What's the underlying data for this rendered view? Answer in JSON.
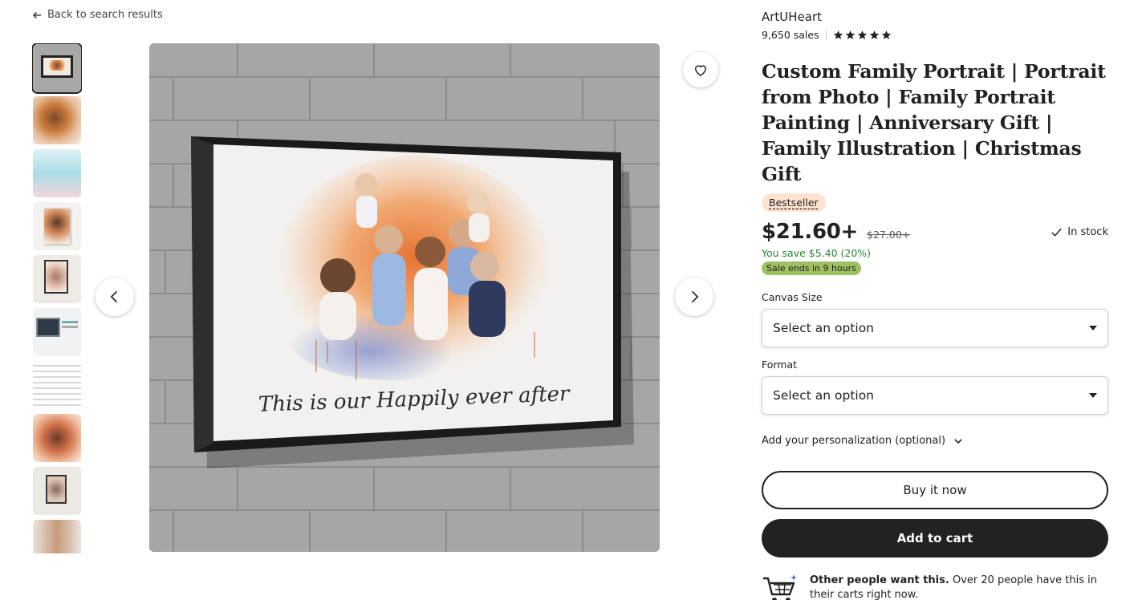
{
  "nav": {
    "back_label": "Back to search results"
  },
  "gallery": {
    "thumbnail_count": 10,
    "active_index": 0,
    "signature_text": "This is our Happily ever after"
  },
  "shop": {
    "name": "ArtUHeart",
    "sales": "9,650 sales",
    "rating_stars": 5
  },
  "listing": {
    "title": "Custom Family Portrait | Portrait from Photo | Family Portrait Painting | Anniversary Gift | Family Illustration | Christmas Gift",
    "badge": "Bestseller",
    "price": "$21.60+",
    "original_price": "$27.00+",
    "stock": "In stock",
    "savings": "You save $5.40 (20%)",
    "sale_ends": "Sale ends in 9 hours"
  },
  "options": {
    "canvas_size": {
      "label": "Canvas Size",
      "value": "Select an option"
    },
    "format": {
      "label": "Format",
      "value": "Select an option"
    }
  },
  "personalization_label": "Add your personalization (optional)",
  "actions": {
    "buy_now": "Buy it now",
    "add_to_cart": "Add to cart"
  },
  "social_proof": {
    "bold": "Other people want this.",
    "text": " Over 20 people have this in their carts right now."
  },
  "colors": {
    "accent_dark": "#222222",
    "sale_green": "#9ec063",
    "save_text": "#258635",
    "badge_bg": "#fde3cf"
  }
}
